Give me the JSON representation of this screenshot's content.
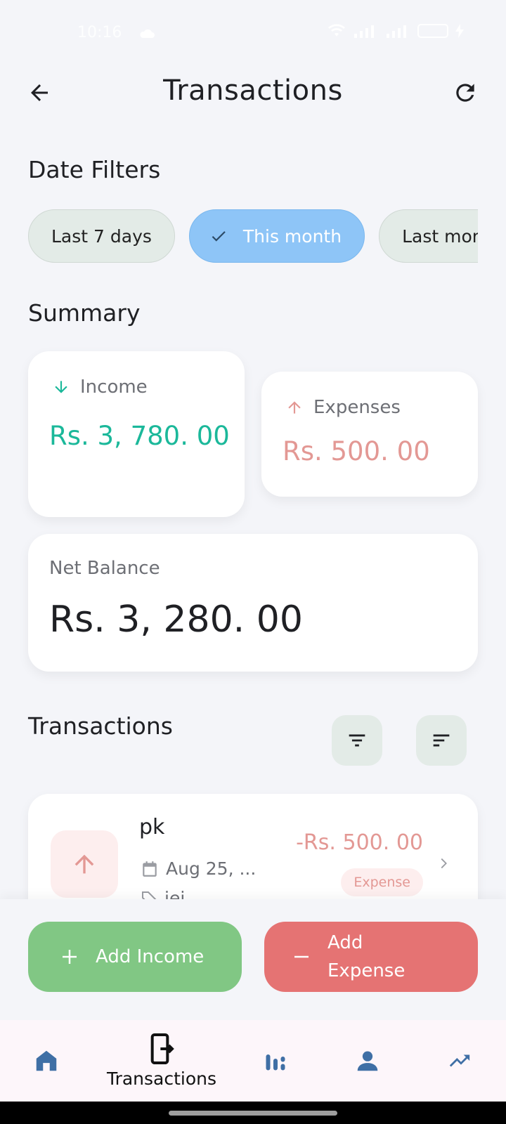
{
  "status_bar": {
    "time": "10:16"
  },
  "header": {
    "title": "Transactions"
  },
  "date_filters": {
    "title": "Date Filters",
    "chips": [
      {
        "label": "Last 7 days",
        "selected": false
      },
      {
        "label": "This month",
        "selected": true
      },
      {
        "label": "Last month",
        "selected": false
      }
    ]
  },
  "summary": {
    "title": "Summary",
    "income": {
      "label": "Income",
      "amount": "Rs.  3, 780. 00"
    },
    "expenses": {
      "label": "Expenses",
      "amount": "Rs.  500. 00"
    },
    "net_balance": {
      "label": "Net Balance",
      "amount": "Rs.  3, 280. 00"
    }
  },
  "transactions": {
    "title": "Transactions",
    "items": [
      {
        "name": "pk",
        "date": "Aug 25, ...",
        "tag": "iei",
        "amount": "-Rs.  500. 00",
        "type": "Expense"
      }
    ]
  },
  "actions": {
    "add_income": "Add Income",
    "add_expense": "Add Expense"
  },
  "bottom_nav": {
    "items": [
      {
        "icon": "home-icon",
        "label": ""
      },
      {
        "icon": "transactions-icon",
        "label": "Transactions",
        "active": true
      },
      {
        "icon": "stats-icon",
        "label": ""
      },
      {
        "icon": "profile-icon",
        "label": ""
      },
      {
        "icon": "trending-icon",
        "label": ""
      }
    ]
  },
  "colors": {
    "income": "#1bb89a",
    "expense": "#e39894",
    "chip_selected": "#8ec5f7",
    "add_income_button": "#81c784",
    "add_expense_button": "#e57373"
  }
}
